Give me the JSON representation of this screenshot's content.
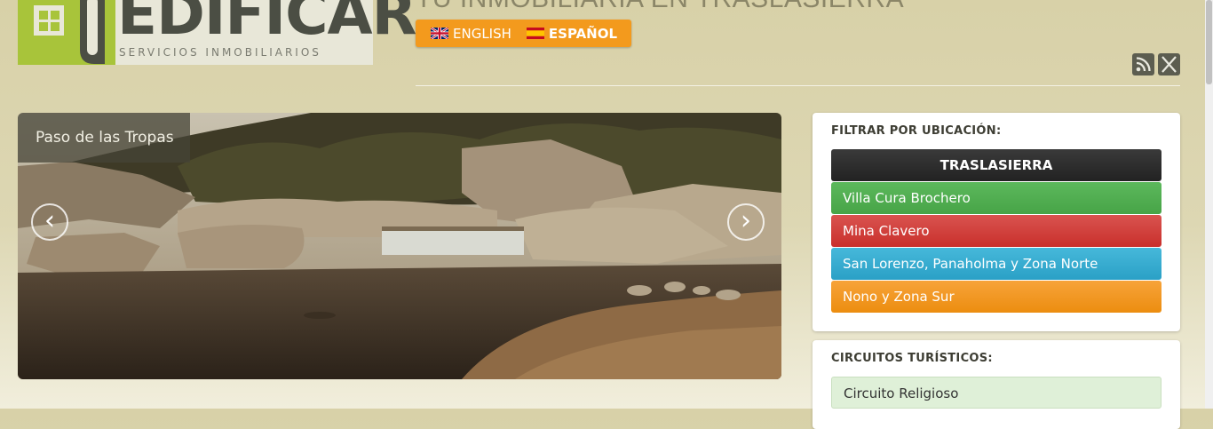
{
  "logo": {
    "title": "EDIFICAR",
    "subtitle": "SERVICIOS INMOBILIARIOS",
    "brand_color": "#a8c43a"
  },
  "header": {
    "tagline": "TU INMOBILIARIA EN TRASLASIERRA"
  },
  "languages": [
    {
      "label": "ENGLISH",
      "flag": "uk-flag-icon",
      "active": false
    },
    {
      "label": "ESPAÑOL",
      "flag": "spain-flag-icon",
      "active": true
    }
  ],
  "social": [
    {
      "icon": "rss-icon"
    },
    {
      "icon": "x-icon"
    }
  ],
  "slider": {
    "caption": "Paso de las Tropas",
    "prev_label": "‹",
    "next_label": "›"
  },
  "location_filter": {
    "title": "FILTRAR POR UBICACIÓN:",
    "header": "TRASLASIERRA",
    "items": [
      {
        "label": "Villa Cura Brochero",
        "color": "#5cb85c"
      },
      {
        "label": "Mina Clavero",
        "color": "#d9534f"
      },
      {
        "label": "San Lorenzo, Panaholma y Zona Norte",
        "color": "#46b8da"
      },
      {
        "label": "Nono y Zona Sur",
        "color": "#f0ad4e"
      }
    ]
  },
  "circuits": {
    "title": "CIRCUITOS TURÍSTICOS:",
    "items": [
      {
        "label": "Circuito Religioso"
      }
    ]
  }
}
